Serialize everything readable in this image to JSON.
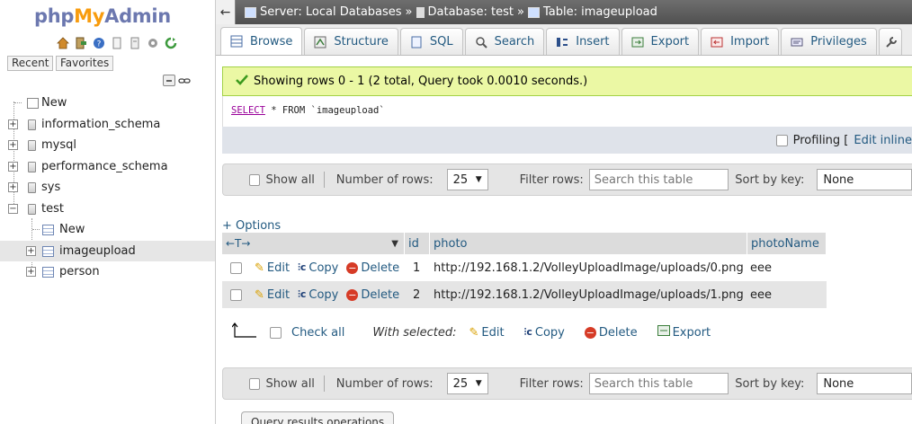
{
  "logo": {
    "php": "php",
    "my": "My",
    "admin": "Admin"
  },
  "nav": {
    "tabs": [
      "Recent",
      "Favorites"
    ],
    "tree": [
      {
        "label": "New",
        "type": "new"
      },
      {
        "label": "information_schema",
        "type": "db"
      },
      {
        "label": "mysql",
        "type": "db"
      },
      {
        "label": "performance_schema",
        "type": "db"
      },
      {
        "label": "sys",
        "type": "db"
      },
      {
        "label": "test",
        "type": "db"
      },
      {
        "label": "New",
        "type": "new"
      },
      {
        "label": "imageupload",
        "type": "table"
      },
      {
        "label": "person",
        "type": "table"
      }
    ]
  },
  "breadcrumb": {
    "server": "Server: Local Databases",
    "database": "Database: test",
    "table": "Table: imageupload",
    "separator": "»"
  },
  "tabs": [
    "Browse",
    "Structure",
    "SQL",
    "Search",
    "Insert",
    "Export",
    "Import",
    "Privileges"
  ],
  "success_message": "Showing rows 0 - 1 (2 total, Query took 0.0010 seconds.)",
  "sql": {
    "keyword": "SELECT",
    "rest": " * FROM `imageupload`"
  },
  "profiling": {
    "label": "Profiling [",
    "link": "Edit inline"
  },
  "navbar": {
    "show_all": "Show all",
    "num_rows_label": "Number of rows:",
    "num_rows_value": "25",
    "filter_label": "Filter rows:",
    "filter_placeholder": "Search this table",
    "sort_label": "Sort by key:",
    "sort_value": "None"
  },
  "options_link": "+ Options",
  "table": {
    "headers": [
      "id",
      "photo",
      "photoName"
    ],
    "row_actions": {
      "edit": "Edit",
      "copy": "Copy",
      "delete": "Delete"
    },
    "rows": [
      {
        "id": "1",
        "photo": "http://192.168.1.2/VolleyUploadImage/uploads/0.png",
        "photoName": "eee"
      },
      {
        "id": "2",
        "photo": "http://192.168.1.2/VolleyUploadImage/uploads/1.png",
        "photoName": "eee"
      }
    ]
  },
  "bulk": {
    "check_all": "Check all",
    "with_selected": "With selected:",
    "edit": "Edit",
    "copy": "Copy",
    "delete": "Delete",
    "export": "Export"
  },
  "query_results_ops": "Query results operations",
  "colors": {
    "link": "#235a81",
    "success_bg": "#ebf8a4",
    "topbar": "#5a5a5a"
  }
}
